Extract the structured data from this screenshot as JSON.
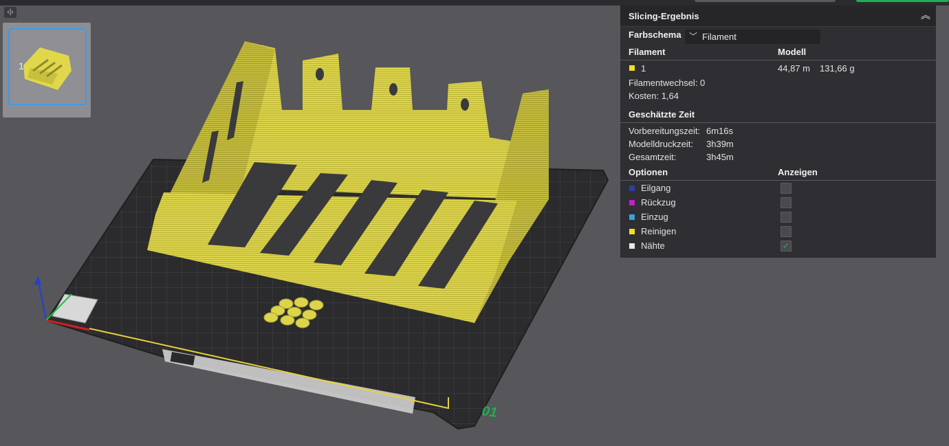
{
  "colors": {
    "accent_green": "#1fae52",
    "model_yellow": "#e0d84a",
    "panel_bg": "#2f2f33",
    "selection_blue": "#3b9be8"
  },
  "sidebar": {
    "collapse_icon": "code-brackets-icon",
    "plate_number": "1"
  },
  "panel": {
    "title": "Slicing-Ergebnis",
    "collapse_icon": "chevron-up-double-icon",
    "color_scheme_label": "Farbschema",
    "color_scheme_value": "Filament",
    "filament_header": "Filament",
    "model_header": "Modell",
    "filament_name": "1",
    "filament_length": "44,87 m",
    "filament_weight": "131,66 g",
    "filament_changes": "Filamentwechsel:  0",
    "cost": "Kosten:  1,64",
    "time_header": "Geschätzte Zeit",
    "prep_time_label": "Vorbereitungszeit:",
    "prep_time_value": "6m16s",
    "model_time_label": "Modelldruckzeit:",
    "model_time_value": "3h39m",
    "total_time_label": "Gesamtzeit:",
    "total_time_value": "3h45m",
    "options_header": "Optionen",
    "display_header": "Anzeigen",
    "options": [
      {
        "label": "Eilgang",
        "color": "#2e3f9e",
        "checked": false
      },
      {
        "label": "Rückzug",
        "color": "#c21ec2",
        "checked": false
      },
      {
        "label": "Einzug",
        "color": "#3aa3d6",
        "checked": false
      },
      {
        "label": "Reinigen",
        "color": "#f0e020",
        "checked": false
      },
      {
        "label": "Nähte",
        "color": "#e8e8e8",
        "checked": true
      }
    ]
  },
  "plate": {
    "label_number": "01"
  }
}
